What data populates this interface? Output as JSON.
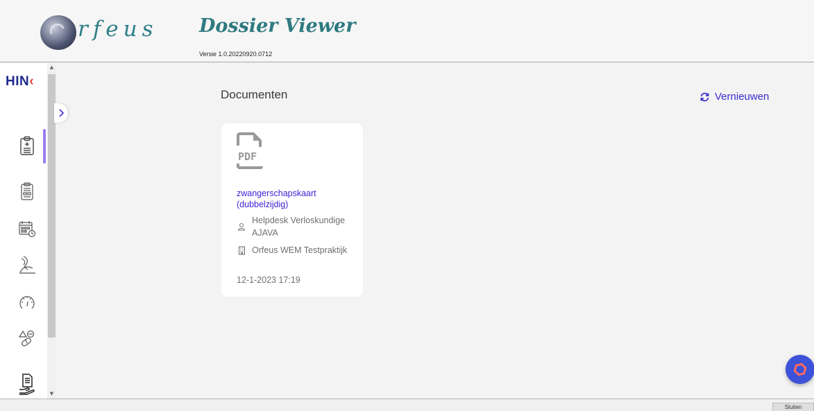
{
  "header": {
    "logo_text": "rfeus",
    "app_title": "Dossier Viewer",
    "version": "Versie 1.0.20220920.0712"
  },
  "sidebar": {
    "brand": "HIN",
    "items": [
      {
        "icon": "clipboard-plus-icon",
        "active": true
      },
      {
        "icon": "clipboard-chart-icon",
        "active": false
      },
      {
        "icon": "calendar-clock-icon",
        "active": false
      },
      {
        "icon": "ultrasound-icon",
        "active": false
      },
      {
        "icon": "gauge-icon",
        "active": false
      },
      {
        "icon": "medication-icon",
        "active": false
      },
      {
        "icon": "document-hand-icon",
        "active": false
      }
    ]
  },
  "main": {
    "title": "Documenten",
    "refresh_label": "Vernieuwen",
    "documents": [
      {
        "type_label": "PDF",
        "name": "zwangerschapskaart (dubbelzijdig)",
        "author": "Helpdesk Verloskundige AJAVA",
        "organization": "Orfeus WEM Testpraktijk",
        "date": "12-1-2023 17:19"
      }
    ]
  },
  "footer": {
    "close_label": "Sluiten"
  },
  "colors": {
    "accent": "#3a2bd0",
    "header_title": "#2e7a80",
    "active_indicator": "#9b7ef0",
    "fab": "#3b52d9"
  }
}
